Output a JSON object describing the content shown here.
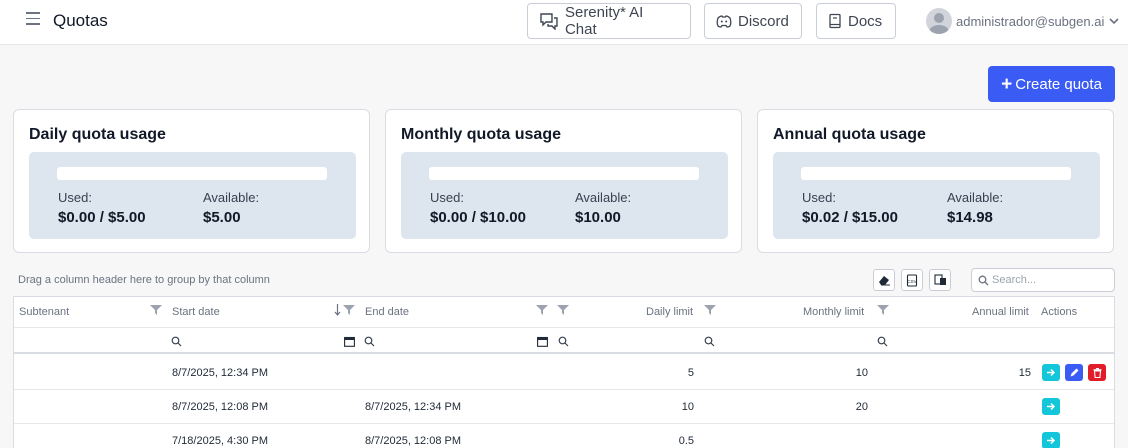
{
  "header": {
    "title": "Quotas",
    "buttons": [
      {
        "label": "Serenity* AI Chat",
        "icon": "chat-icon"
      },
      {
        "label": "Discord",
        "icon": "discord-icon"
      },
      {
        "label": "Docs",
        "icon": "book-icon"
      }
    ],
    "user": "administrador@subgen.ai"
  },
  "create_button": "Create quota",
  "cards": [
    {
      "title": "Daily quota usage",
      "used_label": "Used:",
      "used_value": "$0.00 / $5.00",
      "available_label": "Available:",
      "available_value": "$5.00",
      "progress": 0
    },
    {
      "title": "Monthly quota usage",
      "used_label": "Used:",
      "used_value": "$0.00 / $10.00",
      "available_label": "Available:",
      "available_value": "$10.00",
      "progress": 0
    },
    {
      "title": "Annual quota usage",
      "used_label": "Used:",
      "used_value": "$0.02 / $15.00",
      "available_label": "Available:",
      "available_value": "$14.98",
      "progress": 0.0013
    }
  ],
  "grid": {
    "group_hint": "Drag a column header here to group by that column",
    "search_placeholder": "Search...",
    "columns": [
      "Subtenant",
      "Start date",
      "End date",
      "Daily limit",
      "Monthly limit",
      "Annual limit",
      "Actions"
    ],
    "rows": [
      {
        "subtenant": "",
        "start": "8/7/2025, 12:34 PM",
        "end": "",
        "daily": "5",
        "monthly": "10",
        "annual": "15",
        "actions": [
          "view",
          "edit",
          "delete"
        ]
      },
      {
        "subtenant": "",
        "start": "8/7/2025, 12:08 PM",
        "end": "8/7/2025, 12:34 PM",
        "daily": "10",
        "monthly": "20",
        "annual": "",
        "actions": [
          "view"
        ]
      },
      {
        "subtenant": "",
        "start": "7/18/2025, 4:30 PM",
        "end": "8/7/2025, 12:08 PM",
        "daily": "0.5",
        "monthly": "",
        "annual": "",
        "actions": [
          "view"
        ]
      }
    ]
  },
  "colors": {
    "primary": "#3b5bf5",
    "view": "#14c6d9",
    "delete": "#e11d2a",
    "card_inner": "#dde5ee"
  }
}
